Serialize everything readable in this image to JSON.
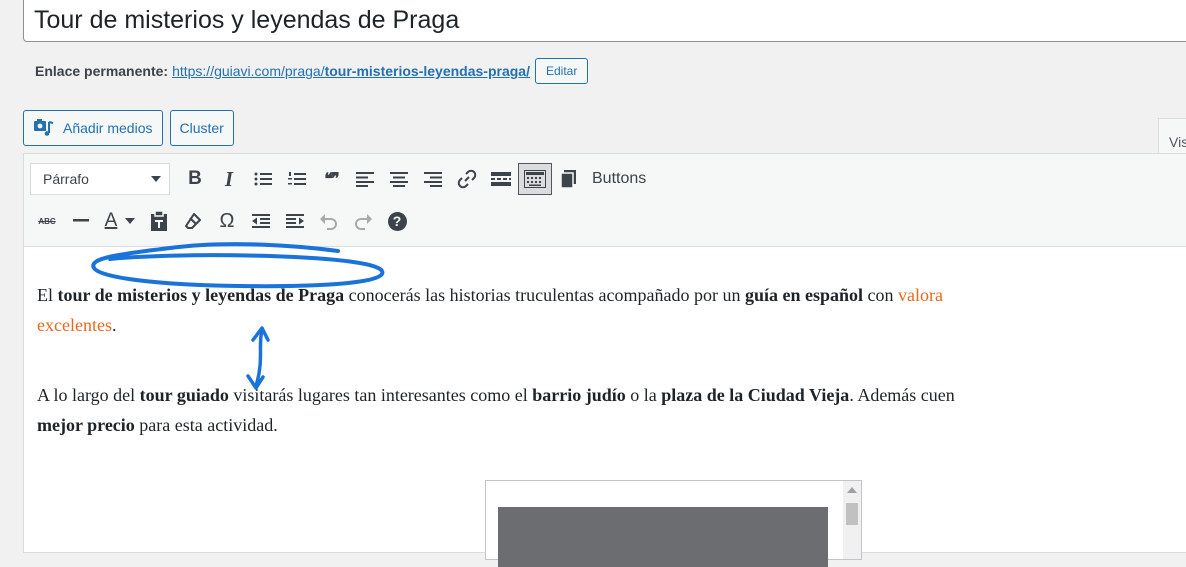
{
  "post": {
    "title": "Tour de misterios y leyendas de Praga"
  },
  "permalink": {
    "label": "Enlace permanente:",
    "url_base": "https://guiavi.com/praga/",
    "url_slug": "tour-misterios-leyendas-praga/",
    "edit_label": "Editar"
  },
  "media_buttons": {
    "add_media": "Añadir medios",
    "cluster": "Cluster"
  },
  "editor_tab": {
    "visual": "Vis"
  },
  "toolbar": {
    "format_select": "Párrafo",
    "buttons_label": "Buttons",
    "row1_icons": [
      "bold-icon",
      "italic-icon",
      "bullet-list-icon",
      "numbered-list-icon",
      "blockquote-icon",
      "align-left-icon",
      "align-center-icon",
      "align-right-icon",
      "link-icon",
      "read-more-icon",
      "toolbar-toggle-icon",
      "shortcode-icon"
    ],
    "row2_icons": [
      "strikethrough-icon",
      "horizontal-line-icon",
      "text-color-icon",
      "paste-text-icon",
      "clear-formatting-icon",
      "special-character-icon",
      "outdent-icon",
      "indent-icon",
      "undo-icon",
      "redo-icon",
      "help-icon"
    ],
    "bold_glyph": "B",
    "italic_glyph": "I",
    "quote_glyph": "❝❞",
    "omega_glyph": "Ω",
    "text_color_glyph": "A",
    "help_glyph": "?",
    "strike_glyph": "ABC"
  },
  "content": {
    "p1": {
      "t1": "El ",
      "b1": "tour de misterios y leyendas de Praga",
      "t2": " conocerás las historias truculentas acompañado por un ",
      "b2": "guía en español",
      "t3": " con ",
      "link1": "valora",
      "link2": "excelentes",
      "t4": "."
    },
    "p2": {
      "t1": "A lo largo del ",
      "b1": "tour guiado",
      "t2": " visitarás lugares tan interesantes como el ",
      "b2": "barrio judío",
      "t3": " o la ",
      "b3": "plaza de la Ciudad Vieja",
      "t4": ". Además cuen",
      "b4": "mejor precio",
      "t5": " para esta actividad."
    }
  },
  "colors": {
    "accent": "#2271b1",
    "link_orange": "#e8691c",
    "annotation": "#1a73d9"
  }
}
